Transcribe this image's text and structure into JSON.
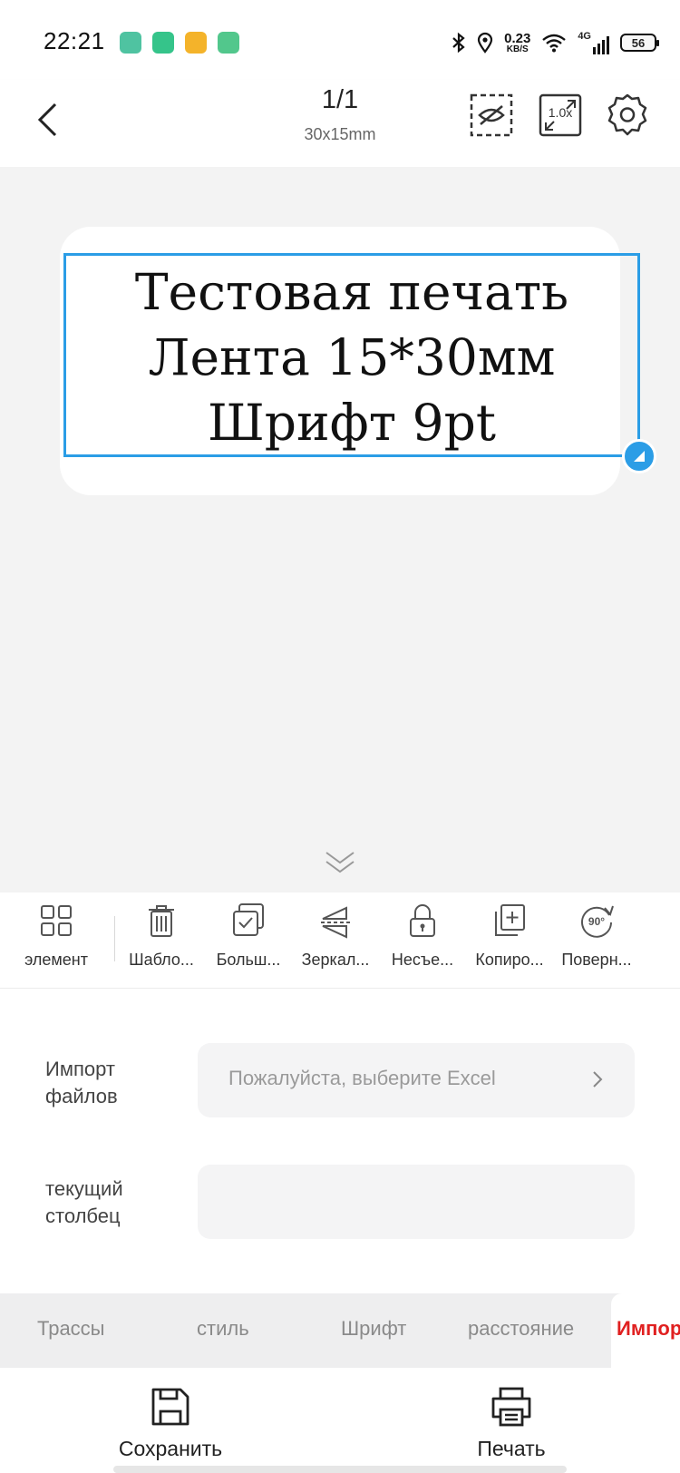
{
  "status_bar": {
    "time": "22:21",
    "net_speed": "0.23",
    "net_unit": "KB/S",
    "network": "4G",
    "battery": "56",
    "app_icon_colors": [
      "#4fc3a1",
      "#35c48a",
      "#f4b32a",
      "#52c78c"
    ]
  },
  "header": {
    "page_indicator": "1/1",
    "label_size": "30x15mm",
    "zoom": "1.0x"
  },
  "canvas": {
    "label_lines": [
      "Тестовая печать",
      "Лента 15*30мм",
      "Шрифт 9pt"
    ],
    "selection_color": "#2b9de6"
  },
  "toolbar": {
    "items": [
      {
        "label": "элемент",
        "icon": "grid-icon"
      },
      {
        "label": "Шабло...",
        "icon": "trash-icon"
      },
      {
        "label": "Больш...",
        "icon": "multi-select-icon"
      },
      {
        "label": "Зеркал...",
        "icon": "mirror-icon"
      },
      {
        "label": "Несъе...",
        "icon": "lock-icon"
      },
      {
        "label": "Копиро...",
        "icon": "copy-icon"
      },
      {
        "label": "Поверн...",
        "icon": "rotate-90-icon"
      }
    ]
  },
  "panel": {
    "import_label": "Импорт файлов",
    "import_placeholder": "Пожалуйста, выберите Excel",
    "column_label": "текущий столбец",
    "column_value": ""
  },
  "tabs": {
    "items": [
      "Трассы",
      "стиль",
      "Шрифт",
      "расстояние"
    ],
    "active": "Импор",
    "active_color": "#e02020"
  },
  "bottom": {
    "save_label": "Сохранить",
    "print_label": "Печать"
  }
}
